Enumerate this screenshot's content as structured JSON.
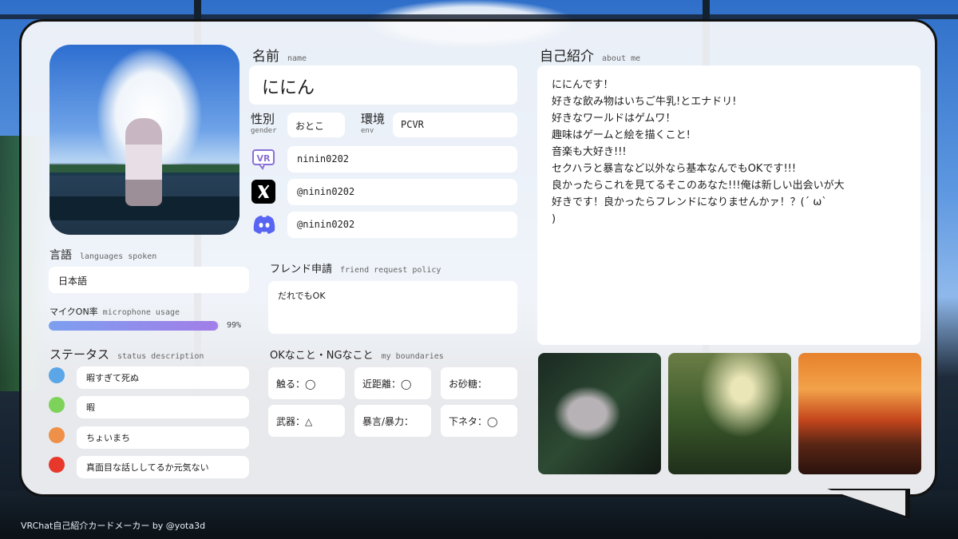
{
  "profile": {
    "name_label": "名前",
    "name_sub": "name",
    "name": "ににん",
    "gender_label": "性別",
    "gender_sub": "gender",
    "gender": "おとこ",
    "env_label": "環境",
    "env_sub": "env",
    "env": "PCVR",
    "vrchat_id": "ninin0202",
    "x_handle": "@ninin0202",
    "discord_handle": "@ninin0202"
  },
  "languages": {
    "label": "言語",
    "sub": "languages spoken",
    "value": "日本語"
  },
  "mic": {
    "label": "マイクON率",
    "sub": "microphone usage",
    "percent_text": "99%",
    "fraction": 0.99
  },
  "status": {
    "label": "ステータス",
    "sub": "status description",
    "items": [
      {
        "color": "#5aa6e6",
        "text": "暇すぎて死ぬ"
      },
      {
        "color": "#7dd35a",
        "text": "暇"
      },
      {
        "color": "#ef9048",
        "text": "ちょいまち"
      },
      {
        "color": "#e8382c",
        "text": "真面目な話ししてるか元気ない"
      }
    ]
  },
  "friend_request": {
    "label": "フレンド申請",
    "sub": "friend request policy",
    "value": "だれでもOK"
  },
  "boundaries": {
    "label": "OKなこと・NGなこと",
    "sub": "my boundaries",
    "items": [
      {
        "text": "触る：◯"
      },
      {
        "text": "近距離：◯"
      },
      {
        "text": "お砂糖："
      },
      {
        "text": "武器：△"
      },
      {
        "text": "暴言/暴力："
      },
      {
        "text": "下ネタ：◯"
      }
    ]
  },
  "about": {
    "label": "自己紹介",
    "sub": "about me",
    "lines": [
      "ににんです！",
      "好きな飲み物はいちご牛乳!とエナドリ!",
      "好きなワールドはゲムワ！",
      "趣味はゲームと絵を描くこと!",
      "音楽も大好き!!!",
      "セクハラと暴言など以外なら基本なんでもOKです!!!",
      "良かったらこれを見てるそこのあなた!!!俺は新しい出会いが大",
      "好きです！良かったらフレンドになりませんかァ！？(´ ω` ",
      ")"
    ]
  },
  "icons": {
    "vrchat": "vr-icon",
    "x": "x-logo-icon",
    "discord": "discord-icon"
  },
  "credit": "VRChat自己紹介カードメーカー by @yota3d"
}
